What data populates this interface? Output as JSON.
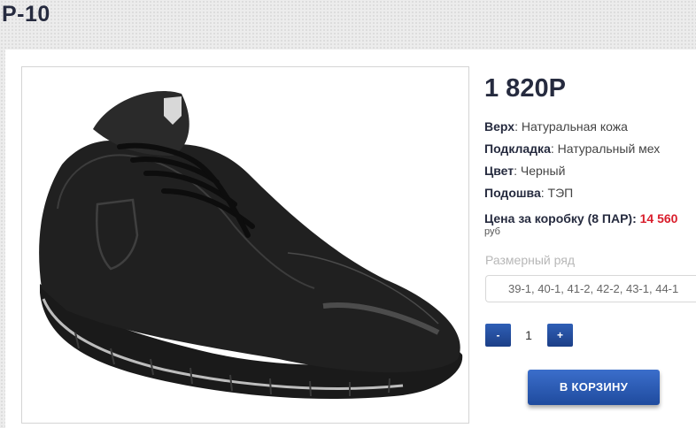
{
  "product": {
    "title": "P-10",
    "price": "1 820Р"
  },
  "specs": [
    {
      "label": "Верх",
      "value": "Натуральная кожа"
    },
    {
      "label": "Подкладка",
      "value": "Натуральный мех"
    },
    {
      "label": "Цвет",
      "value": "Черный"
    },
    {
      "label": "Подошва",
      "value": "ТЭП"
    }
  ],
  "box_price": {
    "label": "Цена за коробку (8 ПАР):",
    "value": "14 560",
    "currency": "руб"
  },
  "sizes": {
    "label": "Размерный ряд",
    "value": "39-1, 40-1, 41-2, 42-2, 43-1, 44-1"
  },
  "quantity": {
    "minus": "-",
    "value": "1",
    "plus": "+"
  },
  "cart": {
    "button_label": "В КОРЗИНУ"
  },
  "image": {
    "icon": "black-leather-shoe-photo"
  },
  "colors": {
    "accent": "#1f4b9e",
    "price_red": "#d91e2c",
    "title": "#262b3f"
  }
}
